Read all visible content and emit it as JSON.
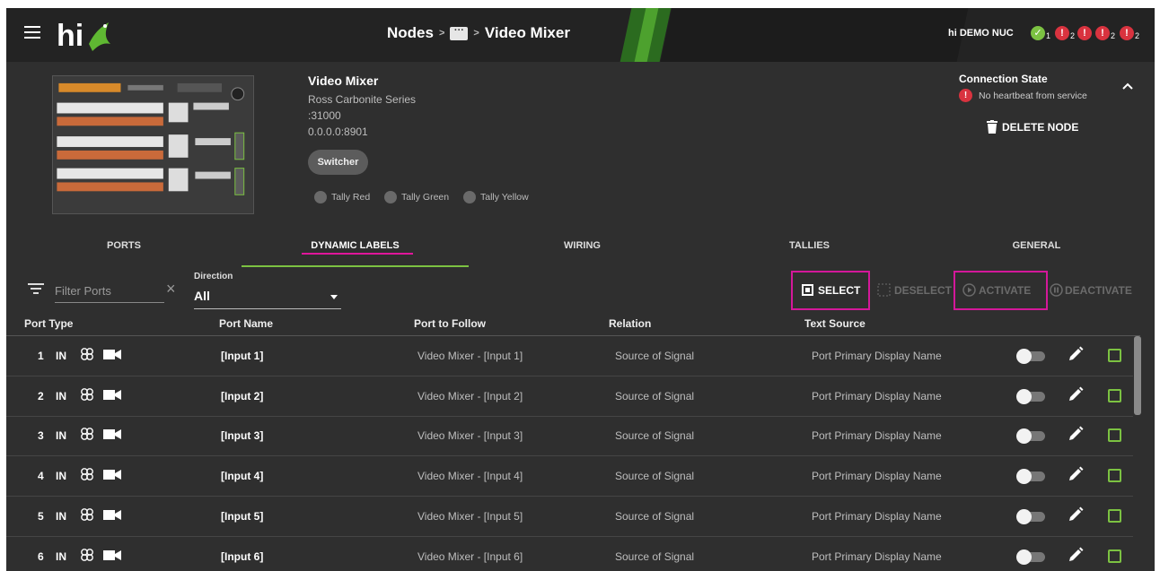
{
  "header": {
    "breadcrumb": [
      "Nodes",
      "Video Mixer"
    ],
    "breadcrumb_sep": ">",
    "breadcrumb_chip": "···",
    "site_name": "hi DEMO NUC",
    "status_indicators": [
      {
        "icon": "check-icon",
        "color": "#7cc242",
        "count": "1",
        "symbol": "✓"
      },
      {
        "icon": "error-icon",
        "color": "#d9333f",
        "count": "2",
        "symbol": "!"
      },
      {
        "icon": "error-icon",
        "color": "#d9333f",
        "count": "",
        "symbol": "!"
      },
      {
        "icon": "error-icon",
        "color": "#d9333f",
        "count": "2",
        "symbol": "!"
      },
      {
        "icon": "error-icon",
        "color": "#d9333f",
        "count": "2",
        "symbol": "!"
      }
    ]
  },
  "node": {
    "title": "Video Mixer",
    "model": "Ross Carbonite Series",
    "port": ":31000",
    "address": "0.0.0.0:8901",
    "tag": "Switcher",
    "tallies": [
      "Tally Red",
      "Tally Green",
      "Tally Yellow"
    ],
    "connection_title": "Connection State",
    "connection_message": "No heartbeat from service",
    "delete_label": "DELETE NODE"
  },
  "tabs": [
    "PORTS",
    "DYNAMIC LABELS",
    "WIRING",
    "TALLIES",
    "GENERAL"
  ],
  "active_tab": "DYNAMIC LABELS",
  "toolbar": {
    "filter_placeholder": "Filter Ports",
    "direction_label": "Direction",
    "direction_value": "All",
    "select": "SELECT",
    "deselect": "DESELECT",
    "activate": "ACTIVATE",
    "deactivate": "DEACTIVATE"
  },
  "table": {
    "columns": [
      "Port Type",
      "Port Name",
      "Port to Follow",
      "Relation",
      "Text Source"
    ],
    "rows": [
      {
        "num": "1",
        "dir": "IN",
        "name": "[Input 1]",
        "follow": "Video Mixer - [Input 1]",
        "relation": "Source of Signal",
        "source": "Port Primary Display Name"
      },
      {
        "num": "2",
        "dir": "IN",
        "name": "[Input 2]",
        "follow": "Video Mixer - [Input 2]",
        "relation": "Source of Signal",
        "source": "Port Primary Display Name"
      },
      {
        "num": "3",
        "dir": "IN",
        "name": "[Input 3]",
        "follow": "Video Mixer - [Input 3]",
        "relation": "Source of Signal",
        "source": "Port Primary Display Name"
      },
      {
        "num": "4",
        "dir": "IN",
        "name": "[Input 4]",
        "follow": "Video Mixer - [Input 4]",
        "relation": "Source of Signal",
        "source": "Port Primary Display Name"
      },
      {
        "num": "5",
        "dir": "IN",
        "name": "[Input 5]",
        "follow": "Video Mixer - [Input 5]",
        "relation": "Source of Signal",
        "source": "Port Primary Display Name"
      },
      {
        "num": "6",
        "dir": "IN",
        "name": "[Input 6]",
        "follow": "Video Mixer - [Input 6]",
        "relation": "Source of Signal",
        "source": "Port Primary Display Name"
      }
    ]
  },
  "colors": {
    "accent_green": "#7cc242",
    "highlight_pink": "#d4189a",
    "error_red": "#d9333f"
  }
}
